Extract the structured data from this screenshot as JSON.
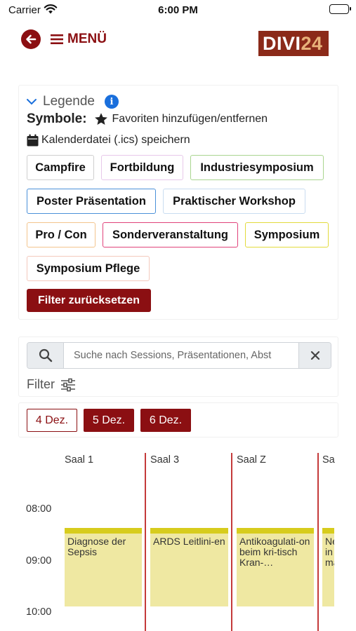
{
  "status_bar": {
    "carrier": "Carrier",
    "time": "6:00 PM"
  },
  "header": {
    "menu_label": "MENÜ",
    "logo_part1": "DIVI",
    "logo_part2": "24"
  },
  "legend": {
    "title": "Legende",
    "symbols_label": "Symbole:",
    "favorites_text": "Favoriten hinzufügen/entfernen",
    "calendar_text": "Kalenderdatei (.ics) speichern",
    "categories": [
      {
        "label": "Campfire",
        "color": "#cfcfcf"
      },
      {
        "label": "Fortbildung",
        "color": "#e7c8ea"
      },
      {
        "label": "Industriesymposium",
        "color": "#a9d58f"
      },
      {
        "label": "Poster Präsentation",
        "color": "#4a90d9"
      },
      {
        "label": "Praktischer Workshop",
        "color": "#c9dcf0"
      },
      {
        "label": "Pro / Con",
        "color": "#f3c48d"
      },
      {
        "label": "Sonderveranstaltung",
        "color": "#e0427a"
      },
      {
        "label": "Symposium",
        "color": "#e2da3c"
      },
      {
        "label": "Symposium Pflege",
        "color": "#f3c9bd"
      }
    ],
    "reset_label": "Filter zurücksetzen"
  },
  "search": {
    "placeholder": "Suche nach Sessions, Präsentationen, Abst",
    "filter_label": "Filter"
  },
  "days": [
    {
      "label": "4 Dez.",
      "active": false
    },
    {
      "label": "5 Dez.",
      "active": true
    },
    {
      "label": "6 Dez.",
      "active": true
    }
  ],
  "schedule": {
    "rooms": [
      "Saal 1",
      "Saal 3",
      "Saal Z",
      "Sa"
    ],
    "times": [
      "08:00",
      "09:00",
      "10:00"
    ],
    "events": [
      {
        "room": "Saal 1",
        "title": "Diagnose der Sepsis"
      },
      {
        "room": "Saal 3",
        "title": "ARDS Leitlini-en"
      },
      {
        "room": "Saal Z",
        "title": "Antikoagulati-on beim kri-tisch Kran-…"
      },
      {
        "room": "Sa",
        "title": "Ne in ma"
      }
    ]
  },
  "colors": {
    "brand": "#8b0f12",
    "event_bg": "#efe8a2",
    "event_bar": "#d7cc1d",
    "column_line": "#c43a3a"
  }
}
